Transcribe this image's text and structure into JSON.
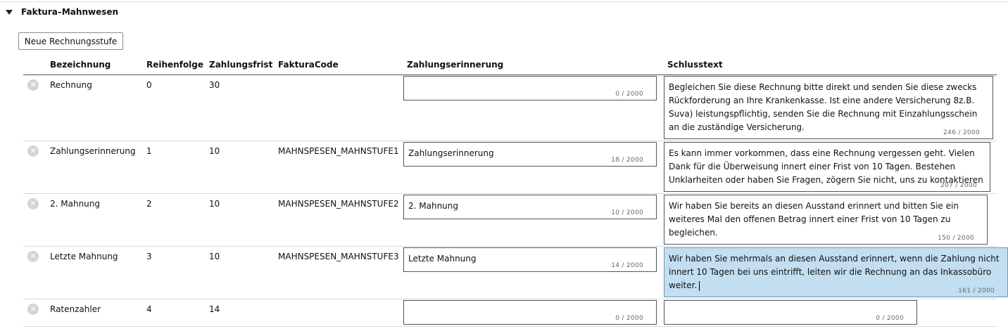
{
  "section": {
    "title": "Faktura–Mahnwesen"
  },
  "toolbar": {
    "new_label": "Neue Rechnungsstufe"
  },
  "columns": {
    "bezeichnung": "Bezeichnung",
    "reihenfolge": "Reihenfolge",
    "zahlungsfrist": "Zahlungsfrist",
    "fakturacode": "FakturaCode",
    "zahlungserinnerung": "Zahlungserinnerung",
    "schlusstext": "Schlusstext"
  },
  "rows": [
    {
      "bezeichnung": "Rechnung",
      "reihenfolge": "0",
      "zahlungsfrist": "30",
      "fakturacode": "",
      "reminder": "",
      "reminder_count": "0 / 2000",
      "closing": "Begleichen Sie diese Rechnung bitte direkt und senden Sie diese zwecks Rückforderung an Ihre Krankenkasse. Ist eine andere Versicherung 8z.B. Suva) leistungspflichtig, senden Sie die Rechnung mit Einzahlungsschein an die zuständige Versicherung.",
      "closing_count": "246 / 2000"
    },
    {
      "bezeichnung": "Zahlungserinnerung",
      "reihenfolge": "1",
      "zahlungsfrist": "10",
      "fakturacode": "MAHNSPESEN_MAHNSTUFE1",
      "reminder": "Zahlungserinnerung",
      "reminder_count": "18 / 2000",
      "closing": "Es kann immer vorkommen, dass eine Rechnung vergessen geht. Vielen Dank für die Überweisung innert einer Frist von 10 Tagen. Bestehen Unklarheiten oder haben Sie Fragen, zögern Sie nicht, uns zu kontaktieren",
      "closing_count": "207 / 2000"
    },
    {
      "bezeichnung": "2. Mahnung",
      "reihenfolge": "2",
      "zahlungsfrist": "10",
      "fakturacode": "MAHNSPESEN_MAHNSTUFE2",
      "reminder": "2. Mahnung",
      "reminder_count": "10 / 2000",
      "closing": "Wir haben Sie bereits an diesen Ausstand erinnert und bitten Sie ein weiteres Mal den offenen Betrag innert einer Frist von 10 Tagen zu begleichen.",
      "closing_count": "150 / 2000"
    },
    {
      "bezeichnung": "Letzte Mahnung",
      "reihenfolge": "3",
      "zahlungsfrist": "10",
      "fakturacode": "MAHNSPESEN_MAHNSTUFE3",
      "reminder": "Letzte Mahnung",
      "reminder_count": "14 / 2000",
      "closing": "Wir haben Sie mehrmals an diesen Ausstand erinnert, wenn die Zahlung nicht innert 10 Tagen bei uns eintrifft, leiten wir die Rechnung an das Inkassobüro weiter.",
      "closing_count": "161 / 2000"
    },
    {
      "bezeichnung": "Ratenzahler",
      "reihenfolge": "4",
      "zahlungsfrist": "14",
      "fakturacode": "",
      "reminder": "",
      "reminder_count": "0 / 2000",
      "closing": "",
      "closing_count": "0 / 2000"
    }
  ]
}
